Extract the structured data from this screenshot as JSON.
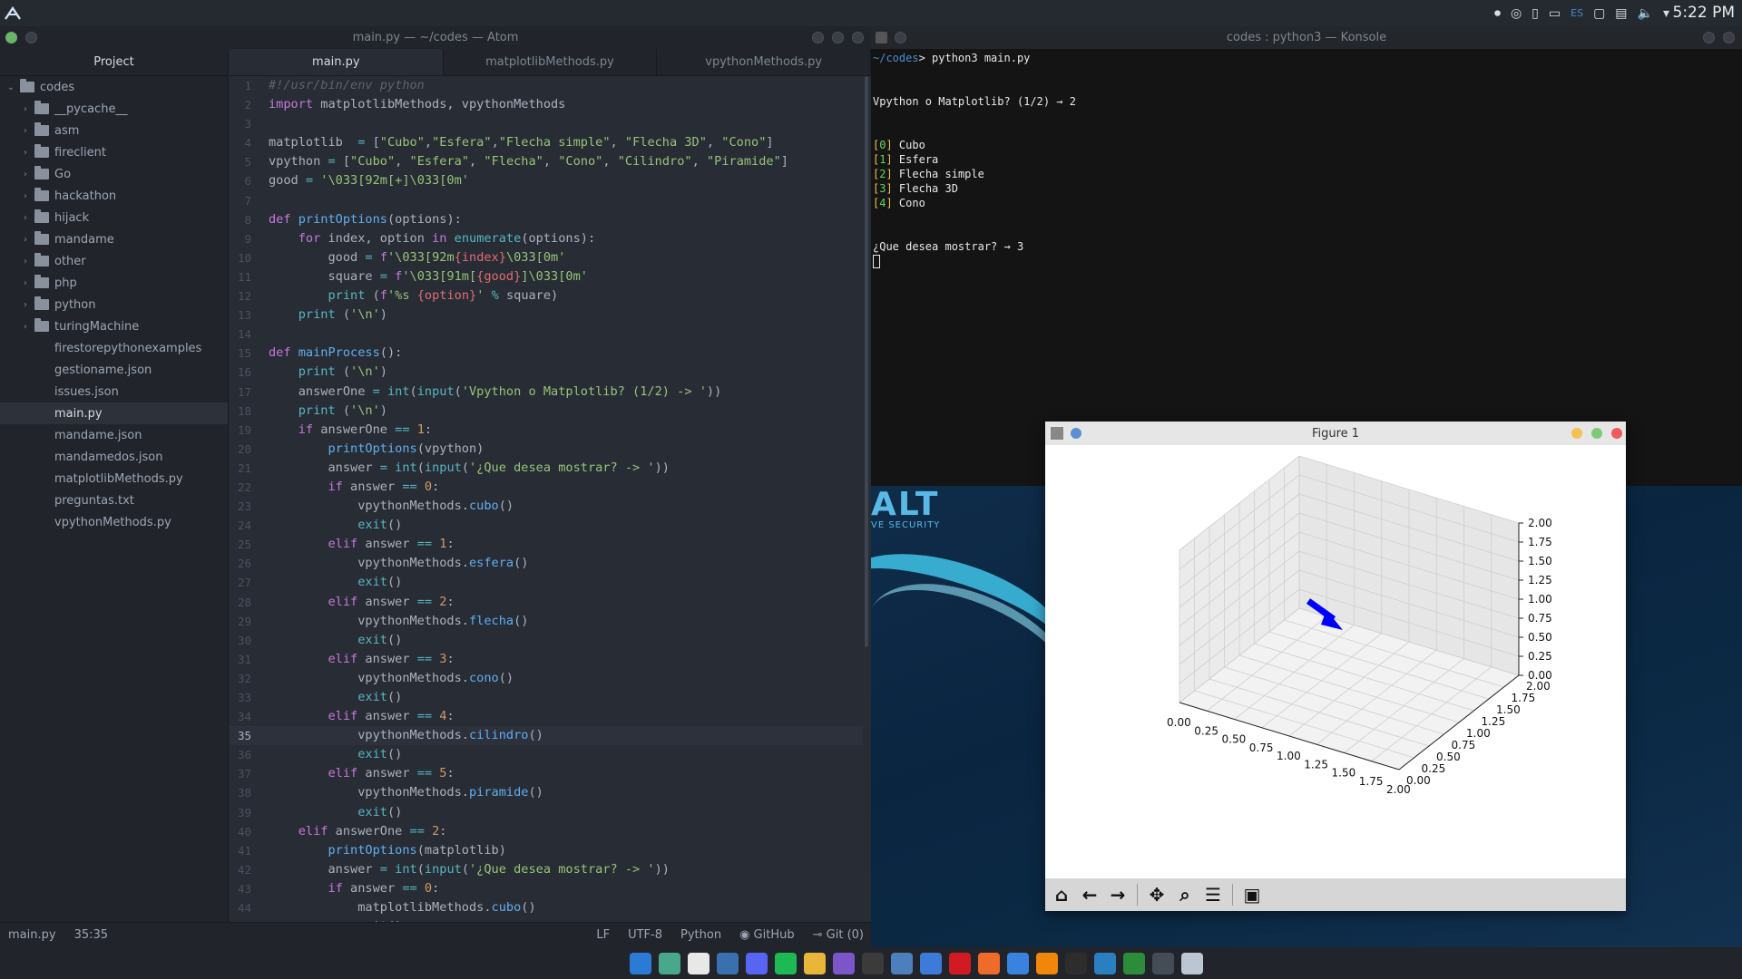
{
  "topbar": {
    "time": "5:22 PM",
    "lang": "ES",
    "tray_icons": [
      "record-icon",
      "steam-icon",
      "phone-icon",
      "battery-icon",
      "display-icon",
      "clipboard-icon",
      "volume-icon",
      "menu-arrow-icon"
    ]
  },
  "atom": {
    "title": "main.py — ~/codes — Atom",
    "project_label": "Project",
    "tree": [
      {
        "name": "codes",
        "type": "root"
      },
      {
        "name": "__pycache__",
        "type": "folder"
      },
      {
        "name": "asm",
        "type": "folder"
      },
      {
        "name": "fireclient",
        "type": "folder"
      },
      {
        "name": "Go",
        "type": "folder"
      },
      {
        "name": "hackathon",
        "type": "folder"
      },
      {
        "name": "hijack",
        "type": "folder"
      },
      {
        "name": "mandame",
        "type": "folder"
      },
      {
        "name": "other",
        "type": "folder"
      },
      {
        "name": "php",
        "type": "folder"
      },
      {
        "name": "python",
        "type": "folder"
      },
      {
        "name": "turingMachine",
        "type": "folder"
      },
      {
        "name": "firestorepythonexamples",
        "type": "file"
      },
      {
        "name": "gestioname.json",
        "type": "file"
      },
      {
        "name": "issues.json",
        "type": "file"
      },
      {
        "name": "main.py",
        "type": "file",
        "selected": true
      },
      {
        "name": "mandame.json",
        "type": "file"
      },
      {
        "name": "mandamedos.json",
        "type": "file"
      },
      {
        "name": "matplotlibMethods.py",
        "type": "file"
      },
      {
        "name": "preguntas.txt",
        "type": "file"
      },
      {
        "name": "vpythonMethods.py",
        "type": "file"
      }
    ],
    "tabs": [
      "main.py",
      "matplotlibMethods.py",
      "vpythonMethods.py"
    ],
    "current_line": 35,
    "code": [
      "#!/usr/bin/env python",
      "import matplotlibMethods, vpythonMethods",
      "",
      "matplotlib  = [\"Cubo\",\"Esfera\",\"Flecha simple\", \"Flecha 3D\", \"Cono\"]",
      "vpython = [\"Cubo\", \"Esfera\", \"Flecha\", \"Cono\", \"Cilindro\", \"Piramide\"]",
      "good = '\\033[92m[+]\\033[0m'",
      "",
      "def printOptions(options):",
      "    for index, option in enumerate(options):",
      "        good = f'\\033[92m{index}\\033[0m'",
      "        square = f'\\033[91m[{good}]\\033[0m'",
      "        print (f'%s {option}' % square)",
      "    print ('\\n')",
      "",
      "def mainProcess():",
      "    print ('\\n')",
      "    answerOne = int(input('Vpython o Matplotlib? (1/2) -> '))",
      "    print ('\\n')",
      "    if answerOne == 1:",
      "        printOptions(vpython)",
      "        answer = int(input('¿Que desea mostrar? -> '))",
      "        if answer == 0:",
      "            vpythonMethods.cubo()",
      "            exit()",
      "        elif answer == 1:",
      "            vpythonMethods.esfera()",
      "            exit()",
      "        elif answer == 2:",
      "            vpythonMethods.flecha()",
      "            exit()",
      "        elif answer == 3:",
      "            vpythonMethods.cono()",
      "            exit()",
      "        elif answer == 4:",
      "            vpythonMethods.cilindro()",
      "            exit()",
      "        elif answer == 5:",
      "            vpythonMethods.piramide()",
      "            exit()",
      "    elif answerOne == 2:",
      "        printOptions(matplotlib)",
      "        answer = int(input('¿Que desea mostrar? -> '))",
      "        if answer == 0:",
      "            matplotlibMethods.cubo()",
      "            exit()"
    ],
    "status": {
      "file": "main.py",
      "cursor": "35:35",
      "eol": "LF",
      "encoding": "UTF-8",
      "grammar": "Python",
      "github": "GitHub",
      "git": "Git (0)"
    }
  },
  "konsole": {
    "title": "codes : python3 — Konsole",
    "prompt_path": "~/codes",
    "command": "python3 main.py",
    "q1": "Vpython o Matplotlib? (1/2) → 2",
    "options": [
      {
        "idx": "0",
        "label": "Cubo"
      },
      {
        "idx": "1",
        "label": "Esfera"
      },
      {
        "idx": "2",
        "label": "Flecha simple"
      },
      {
        "idx": "3",
        "label": "Flecha 3D"
      },
      {
        "idx": "4",
        "label": "Cono"
      }
    ],
    "q2": "¿Que desea mostrar? → 3"
  },
  "desktop": {
    "brand": "ALT",
    "brand_sub": "VE SECURITY"
  },
  "figure": {
    "title": "Figure 1",
    "chart_data": {
      "type": "line",
      "title": "",
      "xlabel": "",
      "ylabel": "",
      "zlabel": "",
      "x_ticks": [
        "0.00",
        "0.25",
        "0.50",
        "0.75",
        "1.00",
        "1.25",
        "1.50",
        "1.75",
        "2.00"
      ],
      "y_ticks": [
        "0.00",
        "0.25",
        "0.50",
        "0.75",
        "1.00",
        "1.25",
        "1.50",
        "1.75",
        "2.00"
      ],
      "z_ticks": [
        "0.00",
        "0.25",
        "0.50",
        "0.75",
        "1.00",
        "1.25",
        "1.50",
        "1.75",
        "2.00"
      ],
      "xlim": [
        0,
        2
      ],
      "ylim": [
        0,
        2
      ],
      "zlim": [
        0,
        2
      ],
      "series": [
        {
          "color": "#0000ff",
          "kind": "3d-arrow"
        }
      ],
      "grid": true
    },
    "toolbar": [
      "home-icon",
      "back-icon",
      "forward-icon",
      "pan-icon",
      "zoom-icon",
      "configure-icon",
      "save-icon"
    ]
  },
  "taskbar": {
    "apps": [
      {
        "name": "vscode-icon",
        "color": "#2b7bd6"
      },
      {
        "name": "chatgpt-icon",
        "color": "#4aa88a"
      },
      {
        "name": "pdf-icon",
        "color": "#e8e8e8"
      },
      {
        "name": "wordpress-icon",
        "color": "#3a6fb0"
      },
      {
        "name": "discord-icon",
        "color": "#5865f2"
      },
      {
        "name": "spotify-icon",
        "color": "#1db954"
      },
      {
        "name": "playstore-icon",
        "color": "#e7b63a"
      },
      {
        "name": "screenshot-icon",
        "color": "#7c56c8"
      },
      {
        "name": "obs-icon",
        "color": "#3b3b3b"
      },
      {
        "name": "files-icon",
        "color": "#4d7fbf"
      },
      {
        "name": "chromium-icon",
        "color": "#3d7bd8"
      },
      {
        "name": "opera-icon",
        "color": "#d11a22"
      },
      {
        "name": "firefox-icon",
        "color": "#ef6b2a"
      },
      {
        "name": "web-icon",
        "color": "#3a82e0"
      },
      {
        "name": "vlc-icon",
        "color": "#f0860a"
      },
      {
        "name": "terminal-icon",
        "color": "#2d2d2d"
      },
      {
        "name": "wireshark-icon",
        "color": "#2a7fc0"
      },
      {
        "name": "anydesk-icon",
        "color": "#2c8c3a"
      },
      {
        "name": "settings-icon",
        "color": "#444c55"
      },
      {
        "name": "kali-icon",
        "color": "#bcc6d2"
      }
    ]
  }
}
